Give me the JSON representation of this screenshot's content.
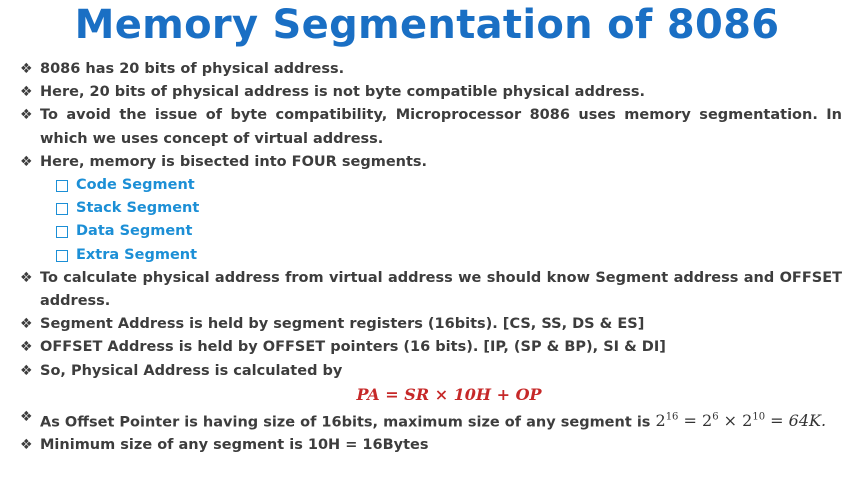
{
  "slide": {
    "title": "Memory Segmentation of 8086",
    "bullet_glyph": "❖",
    "points": [
      "8086 has 20 bits of physical address.",
      "Here, 20 bits of physical address is not byte compatible physical address.",
      "To avoid the issue of byte compatibility, Microprocessor 8086 uses memory segmentation. In which we uses concept of virtual address.",
      "Here, memory is bisected into FOUR segments.",
      "To calculate physical address from virtual address we should know Segment address and OFFSET address.",
      "Segment Address is held by segment registers (16bits). [CS, SS, DS & ES]",
      "OFFSET Address is held by OFFSET pointers (16 bits). [IP, (SP & BP), SI & DI]",
      "So, Physical Address is calculated by",
      "As Offset Pointer is having size of 16bits, maximum size of any segment is",
      "Minimum size of any segment is 10H = 16Bytes"
    ],
    "segments": [
      "Code Segment",
      "Stack Segment",
      "Data Segment",
      "Extra Segment"
    ],
    "formula": "PA = SR × 10H + OP",
    "max_size_math": {
      "base1": "2",
      "exp1": "16",
      "eq1": " = ",
      "base2": "2",
      "exp2": "6",
      "times": " × ",
      "base3": "2",
      "exp3": "10",
      "eq2": " = ",
      "result": "64K."
    }
  }
}
